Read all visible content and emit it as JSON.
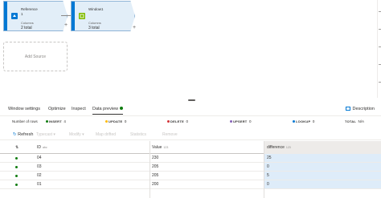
{
  "canvas": {
    "nodes": [
      {
        "title": "Reference",
        "subtitle": "1",
        "metric_label": "Columns",
        "metric_value": "2 total"
      },
      {
        "title": "Window1",
        "subtitle": "",
        "metric_label": "Columns",
        "metric_value": "3 total"
      }
    ],
    "add_source_label": "Add Source"
  },
  "tabs": {
    "items": [
      "Window settings",
      "Optimize",
      "Inspect",
      "Data preview"
    ],
    "active": "Data preview",
    "description_label": "Description"
  },
  "stats": {
    "rows_label": "Number of rows",
    "insert_label": "INSERT",
    "insert_value": "4",
    "update_label": "UPDATE",
    "update_value": "0",
    "delete_label": "DELETE",
    "delete_value": "0",
    "upsert_label": "UPSERT",
    "upsert_value": "0",
    "lookup_label": "LOOKUP",
    "lookup_value": "0",
    "total_label": "TOTAL",
    "total_value": "N/A",
    "colors": {
      "insert": "#107c10",
      "update": "#ffb900",
      "delete": "#d13438",
      "upsert": "#8764b8",
      "lookup": "#0078d4"
    }
  },
  "toolbar": {
    "refresh_label": "Refresh",
    "disabled_items": [
      "Typecast",
      "Modify",
      "Map drifted",
      "Statistics",
      "Remove"
    ]
  },
  "grid": {
    "columns": [
      {
        "name": "ID",
        "type": "abc"
      },
      {
        "name": "Value",
        "type": "123"
      },
      {
        "name": "difference",
        "type": "123"
      }
    ],
    "rows": [
      [
        "04",
        "230",
        "25"
      ],
      [
        "03",
        "205",
        "0"
      ],
      [
        "02",
        "205",
        "5"
      ],
      [
        "01",
        "200",
        "0"
      ]
    ]
  }
}
